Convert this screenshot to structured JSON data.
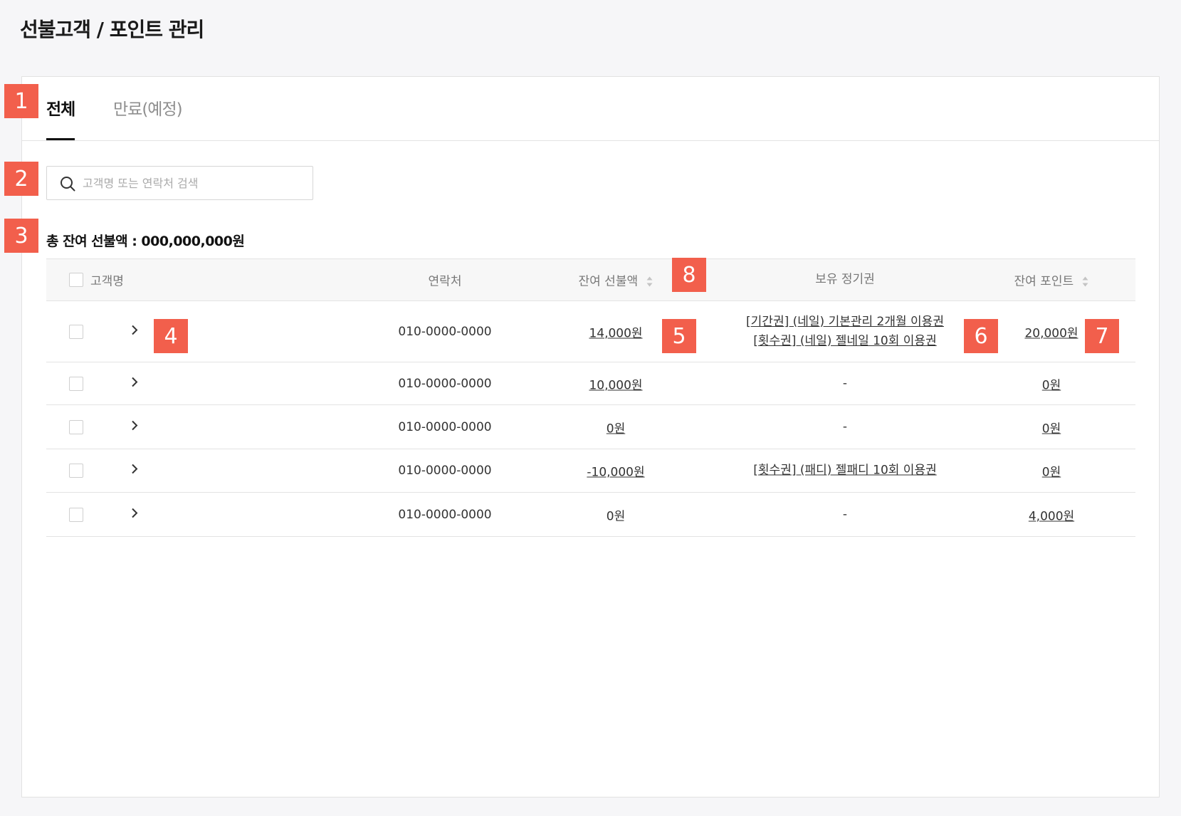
{
  "page": {
    "title": "선불고객 / 포인트 관리"
  },
  "tabs": [
    {
      "label": "전체",
      "active": true
    },
    {
      "label": "만료(예정)",
      "active": false
    }
  ],
  "search": {
    "placeholder": "고객명 또는 연락처 검색",
    "value": ""
  },
  "summary": {
    "total_label": "총 잔여 선불액 : 000,000,000원"
  },
  "table": {
    "columns": [
      "고객명",
      "연락처",
      "잔여 선불액",
      "보유 정기권",
      "잔여 포인트"
    ],
    "rows": [
      {
        "name": "",
        "phone": "010-0000-0000",
        "prepaid": "14,000원",
        "passes": [
          "[기간권] (네일) 기본관리 2개월 이용권",
          "[횟수권] (네일) 젤네일 10회 이용권"
        ],
        "points": "20,000원"
      },
      {
        "name": "",
        "phone": "010-0000-0000",
        "prepaid": "10,000원",
        "passes": [
          "-"
        ],
        "points": "0원"
      },
      {
        "name": "",
        "phone": "010-0000-0000",
        "prepaid": "0원",
        "passes": [
          "-"
        ],
        "points": "0원"
      },
      {
        "name": "",
        "phone": "010-0000-0000",
        "prepaid": "-10,000원",
        "passes": [
          "[횟수권] (패디) 젤패디 10회 이용권"
        ],
        "points": "0원"
      },
      {
        "name": "",
        "phone": "010-0000-0000",
        "prepaid": "0원",
        "passes": [
          "-"
        ],
        "points": "4,000원"
      }
    ]
  },
  "annotations": [
    "1",
    "2",
    "3",
    "4",
    "5",
    "6",
    "7",
    "8"
  ],
  "colors": {
    "marker": "#f25f4c",
    "border": "#e3e3e3",
    "header_bg": "#f7f7f7"
  },
  "icons": {
    "search": "search-icon",
    "expand": "chevron-right-icon",
    "sort": "sort-icon"
  }
}
